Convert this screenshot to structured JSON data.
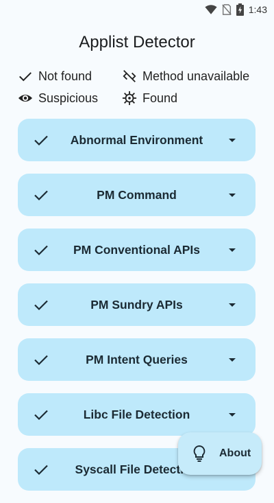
{
  "status_bar": {
    "time": "1:43"
  },
  "app": {
    "title": "Applist Detector"
  },
  "legend": {
    "not_found": "Not found",
    "method_unavailable": "Method unavailable",
    "suspicious": "Suspicious",
    "found": "Found"
  },
  "cards": [
    {
      "label": "Abnormal Environment",
      "status": "not_found"
    },
    {
      "label": "PM Command",
      "status": "not_found"
    },
    {
      "label": "PM Conventional APIs",
      "status": "not_found"
    },
    {
      "label": "PM Sundry APIs",
      "status": "not_found"
    },
    {
      "label": "PM Intent Queries",
      "status": "not_found"
    },
    {
      "label": "Libc File Detection",
      "status": "not_found"
    },
    {
      "label": "Syscall File Detection",
      "status": "not_found"
    }
  ],
  "fab": {
    "label": "About"
  },
  "colors": {
    "card_bg": "#bee9fb",
    "page_bg": "#f7fbfe",
    "fab_bg": "#c6ebfa"
  }
}
